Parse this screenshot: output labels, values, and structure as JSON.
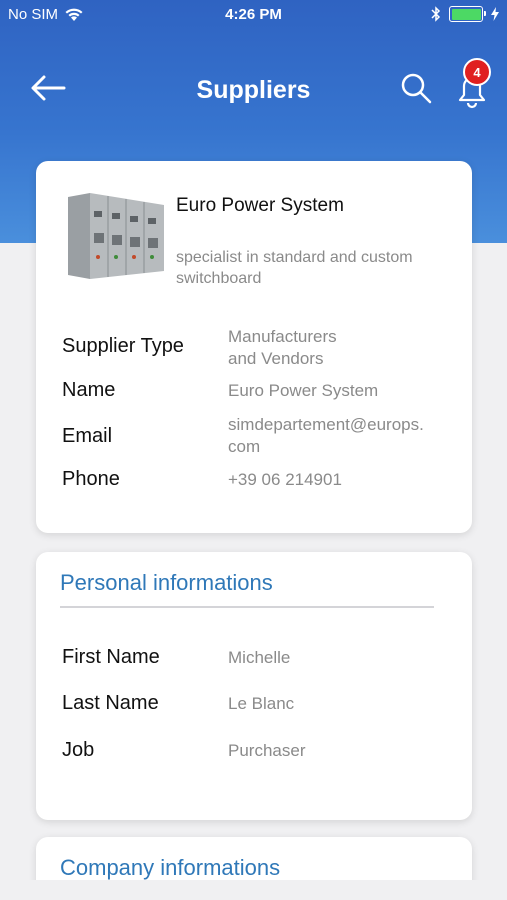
{
  "status_bar": {
    "carrier": "No SIM",
    "time": "4:26 PM"
  },
  "navbar": {
    "title": "Suppliers",
    "notification_count": "4"
  },
  "supplier": {
    "company_name": "Euro Power System",
    "description": "specialist in standard and custom switchboard",
    "fields": [
      {
        "label": "Supplier Type",
        "value": "Manufacturers\nand Vendors"
      },
      {
        "label": "Name",
        "value": "Euro Power System"
      },
      {
        "label": "Email",
        "value": "simdepartement@europs.\ncom"
      },
      {
        "label": "Phone",
        "value": "+39 06 214901"
      }
    ]
  },
  "personal": {
    "title": "Personal informations",
    "fields": [
      {
        "label": "First Name",
        "value": "Michelle"
      },
      {
        "label": "Last Name",
        "value": "Le Blanc"
      },
      {
        "label": "Job",
        "value": "Purchaser"
      }
    ]
  },
  "company": {
    "title": "Company informations"
  },
  "colors": {
    "header_top": "#2f63c2",
    "header_bottom": "#4a8fdc",
    "section_title": "#2f78b8",
    "badge": "#e02020",
    "battery": "#4cd964"
  }
}
